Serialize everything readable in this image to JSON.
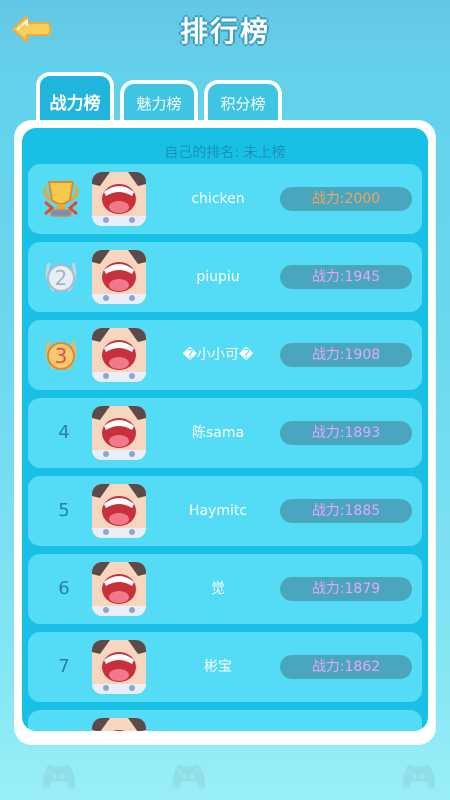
{
  "header": {
    "title": "排行榜"
  },
  "tabs": [
    {
      "label": "战力榜",
      "active": true
    },
    {
      "label": "魅力榜",
      "active": false
    },
    {
      "label": "积分榜",
      "active": false
    }
  ],
  "my_rank": "自己的排名: 未上榜",
  "rows": [
    {
      "rank": "1",
      "medal": "gold-trophy",
      "name": "chicken",
      "power": "战力:2000"
    },
    {
      "rank": "2",
      "medal": "silver-medal",
      "name": "piupiu",
      "power": "战力:1945"
    },
    {
      "rank": "3",
      "medal": "bronze-medal",
      "name": "�小小可�",
      "power": "战力:1908"
    },
    {
      "rank": "4",
      "name": "陈sama",
      "power": "战力:1893"
    },
    {
      "rank": "5",
      "name": "Haymitc",
      "power": "战力:1885"
    },
    {
      "rank": "6",
      "name": "觉",
      "power": "战力:1879"
    },
    {
      "rank": "7",
      "name": "彬宝",
      "power": "战力:1862"
    }
  ],
  "colors": {
    "gold_text": "#f3a45e",
    "power_text": "#eaa6f4",
    "panel": "#17c0e4",
    "row": "#54dcf6"
  }
}
